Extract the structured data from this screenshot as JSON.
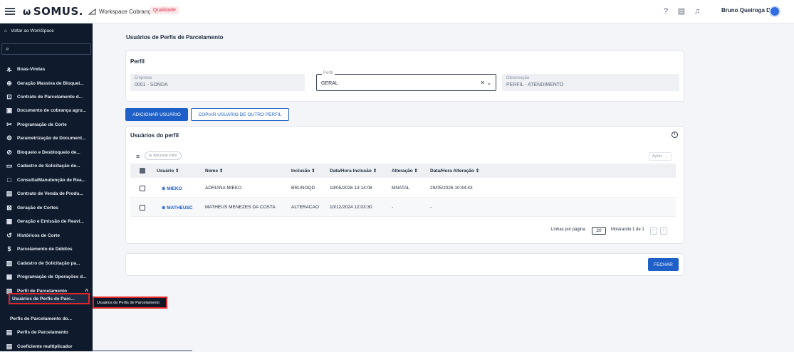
{
  "header": {
    "logo": "SOMUS.",
    "workspace": "Workspace Cobrança",
    "env_badge": "Qualidade",
    "user_name": "Bruno Queiroga D..."
  },
  "sidebar": {
    "back": "Voltar ao WorkSpace",
    "search_icon": "search-icon",
    "items": [
      {
        "label": "Boas-Vindas",
        "icon": "people-icon"
      },
      {
        "label": "Geração Massiva de Bloquei...",
        "icon": "plus-circle-icon"
      },
      {
        "label": "Contrato de Parcelamento d...",
        "icon": "document-edit-icon"
      },
      {
        "label": "Documento de cobrança agru...",
        "icon": "document-group-icon"
      },
      {
        "label": "Programação de Corte",
        "icon": "scissors-icon"
      },
      {
        "label": "Parametrização de Document...",
        "icon": "settings-person-icon"
      },
      {
        "label": "Bloqueio e Desbloqueio de...",
        "icon": "block-icon"
      },
      {
        "label": "Cadastro de Solicitação de...",
        "icon": "form-icon"
      },
      {
        "label": "Consulta/Manutenção de Rea...",
        "icon": "square-icon"
      },
      {
        "label": "Contrato de Venda de Produ...",
        "icon": "contract-icon"
      },
      {
        "label": "Geração de Cortes",
        "icon": "cut-box-icon"
      },
      {
        "label": "Geração e Emissão de Reavi...",
        "icon": "notice-icon"
      },
      {
        "label": "Históricos de Corte",
        "icon": "history-icon"
      },
      {
        "label": "Parcelamento de Débitos",
        "icon": "dollar-icon"
      },
      {
        "label": "Cadastro de Solicitação pa...",
        "icon": "card-icon"
      },
      {
        "label": "Programação de Operações d...",
        "icon": "calendar-icon"
      },
      {
        "label": "Perfil de Parcelamento",
        "icon": "profile-card-icon"
      },
      {
        "label": "Usuários de Perfis de Parc...",
        "icon": ""
      },
      {
        "label": "Perfis de Parcelamento do...",
        "icon": ""
      },
      {
        "label": "Perfis de Parcelamento",
        "icon": "list-icon"
      },
      {
        "label": "Coeficiente multiplicador",
        "icon": "list-icon"
      }
    ],
    "tooltip": "Usuários de Perfis de Parcelamento"
  },
  "page": {
    "title": "Usuários de Perfis de Parcelamento"
  },
  "perfil": {
    "title": "Perfil",
    "empresa_label": "Empresa",
    "empresa_value": "0001 - SONDA",
    "perfil_label": "Perfil",
    "perfil_value": "GERAL",
    "obs_label": "Observação",
    "obs_value": "PERFIL - ATENDIMENTO"
  },
  "actions": {
    "add_user": "ADICIONAR USUÁRIO",
    "copy_user": "COPIAR USUÁRIO DE OUTRO PERFIL",
    "close": "FECHAR"
  },
  "users": {
    "title": "Usuários do perfil",
    "add_filter": "Adicionar Filtro",
    "acoes": "Ações",
    "columns": [
      "Usuário",
      "Nome",
      "Inclusão",
      "Data/Hora Inclusão",
      "Alteração",
      "Data/Hora Alteração"
    ],
    "rows": [
      {
        "usuario": "MIEKO",
        "nome": "ADRIANA MIEKO",
        "inclusao": "BRUNOQD",
        "dh_inclusao": "19/05/2026 13:14:08",
        "alteracao": "MNATAL",
        "dh_alteracao": "29/05/2026 10:44:43"
      },
      {
        "usuario": "MATHEUSC",
        "nome": "MATHEUS MENEZES DA COSTA",
        "inclusao": "ALTERACAO",
        "dh_inclusao": "10/12/2024 12:03:30",
        "alteracao": "-",
        "dh_alteracao": "-"
      }
    ],
    "rows_per_page_label": "Linhas por página",
    "rows_per_page": "20",
    "showing": "Mostrando 1 de 1"
  }
}
